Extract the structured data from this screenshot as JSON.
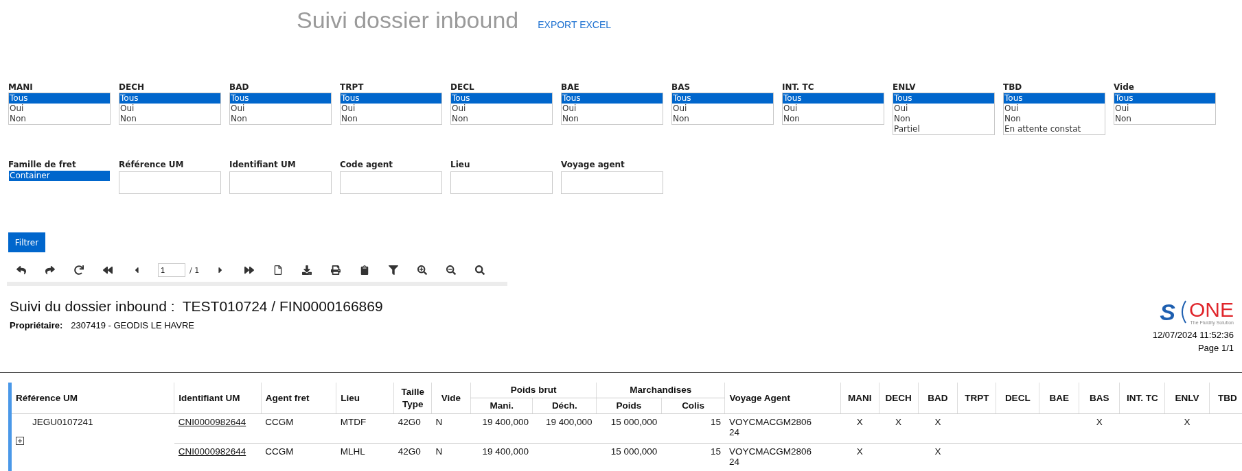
{
  "header": {
    "title": "Suivi dossier inbound",
    "export_link": "EXPORT EXCEL"
  },
  "filters": [
    {
      "label": "MANI",
      "options": [
        {
          "label": "Tous",
          "selected": true
        },
        {
          "label": "Oui",
          "selected": false
        },
        {
          "label": "Non",
          "selected": false
        }
      ]
    },
    {
      "label": "DECH",
      "options": [
        {
          "label": "Tous",
          "selected": true
        },
        {
          "label": "Oui",
          "selected": false
        },
        {
          "label": "Non",
          "selected": false
        }
      ]
    },
    {
      "label": "BAD",
      "options": [
        {
          "label": "Tous",
          "selected": true
        },
        {
          "label": "Oui",
          "selected": false
        },
        {
          "label": "Non",
          "selected": false
        }
      ]
    },
    {
      "label": "TRPT",
      "options": [
        {
          "label": "Tous",
          "selected": true
        },
        {
          "label": "Oui",
          "selected": false
        },
        {
          "label": "Non",
          "selected": false
        }
      ]
    },
    {
      "label": "DECL",
      "options": [
        {
          "label": "Tous",
          "selected": true
        },
        {
          "label": "Oui",
          "selected": false
        },
        {
          "label": "Non",
          "selected": false
        }
      ]
    },
    {
      "label": "BAE",
      "options": [
        {
          "label": "Tous",
          "selected": true
        },
        {
          "label": "Oui",
          "selected": false
        },
        {
          "label": "Non",
          "selected": false
        }
      ]
    },
    {
      "label": "BAS",
      "options": [
        {
          "label": "Tous",
          "selected": true
        },
        {
          "label": "Oui",
          "selected": false
        },
        {
          "label": "Non",
          "selected": false
        }
      ]
    },
    {
      "label": "INT. TC",
      "options": [
        {
          "label": "Tous",
          "selected": true
        },
        {
          "label": "Oui",
          "selected": false
        },
        {
          "label": "Non",
          "selected": false
        }
      ]
    },
    {
      "label": "ENLV",
      "options": [
        {
          "label": "Tous",
          "selected": true
        },
        {
          "label": "Oui",
          "selected": false
        },
        {
          "label": "Non",
          "selected": false
        },
        {
          "label": "Partiel",
          "selected": false
        }
      ]
    },
    {
      "label": "TBD",
      "options": [
        {
          "label": "Tous",
          "selected": true
        },
        {
          "label": "Oui",
          "selected": false
        },
        {
          "label": "Non",
          "selected": false
        },
        {
          "label": "En attente constat",
          "selected": false
        }
      ]
    },
    {
      "label": "Vide",
      "options": [
        {
          "label": "Tous",
          "selected": true
        },
        {
          "label": "Oui",
          "selected": false
        },
        {
          "label": "Non",
          "selected": false
        }
      ]
    }
  ],
  "fields": [
    {
      "label": "Famille de fret",
      "kind": "listbox",
      "options": [
        {
          "label": "Container",
          "selected": true
        }
      ]
    },
    {
      "label": "Référence UM",
      "kind": "text"
    },
    {
      "label": "Identifiant UM",
      "kind": "text"
    },
    {
      "label": "Code agent",
      "kind": "text"
    },
    {
      "label": "Lieu",
      "kind": "text"
    },
    {
      "label": "Voyage agent",
      "kind": "text"
    }
  ],
  "filter_button": "Filtrer",
  "toolbar": {
    "page": "1",
    "total": "/ 1"
  },
  "report": {
    "title": "Suivi du dossier inbound :  TEST010724 / FIN0000166869",
    "owner_label": "Propriétaire:",
    "owner": "2307419 - GEODIS LE HAVRE",
    "logo": {
      "mark": "S",
      "name": "ONE",
      "tagline": "The Fluidity Solution"
    },
    "date": "12/07/2024 11:52:36",
    "page": "Page 1/1"
  },
  "table": {
    "columns": [
      {
        "kind": "single",
        "label": "Référence UM"
      },
      {
        "kind": "single",
        "label": "Identifiant UM"
      },
      {
        "kind": "single",
        "label": "Agent fret"
      },
      {
        "kind": "single",
        "label": "Lieu"
      },
      {
        "kind": "single",
        "label": "Taille Type"
      },
      {
        "kind": "single",
        "label": "Vide"
      },
      {
        "kind": "group",
        "label": "Poids brut",
        "children": [
          "Mani.",
          "Déch."
        ]
      },
      {
        "kind": "group",
        "label": "Marchandises",
        "children": [
          "Poids",
          "Colis"
        ]
      },
      {
        "kind": "single",
        "label": "Voyage Agent"
      },
      {
        "kind": "single",
        "label": "MANI"
      },
      {
        "kind": "single",
        "label": "DECH"
      },
      {
        "kind": "single",
        "label": "BAD"
      },
      {
        "kind": "single",
        "label": "TRPT"
      },
      {
        "kind": "single",
        "label": "DECL"
      },
      {
        "kind": "single",
        "label": "BAE"
      },
      {
        "kind": "single",
        "label": "BAS"
      },
      {
        "kind": "single",
        "label": "INT. TC"
      },
      {
        "kind": "single",
        "label": "ENLV"
      },
      {
        "kind": "single",
        "label": "TBD"
      }
    ],
    "groups": [
      {
        "reference": "JEGU0107241",
        "expanded": false,
        "rows": [
          {
            "identifiant": "CNI0000982644",
            "agent": "CCGM",
            "lieu": "MTDF",
            "type": "42G0",
            "vide": "N",
            "mani": "19 400,000",
            "dech": "19 400,000",
            "poids": "15 000,000",
            "colis": "15",
            "voyage": "VOYCMACGM280624",
            "flags": {
              "mani": "X",
              "dech": "X",
              "bad": "X",
              "bas": "X",
              "enlv": "X"
            }
          },
          {
            "identifiant": "CNI0000982644",
            "agent": "CCGM",
            "lieu": "MLHL",
            "type": "42G0",
            "vide": "N",
            "mani": "19 400,000",
            "poids": "15 000,000",
            "colis": "15",
            "voyage": "VOYCMACGM280624",
            "flags": {
              "mani": "X",
              "bad": "X"
            }
          }
        ]
      }
    ]
  }
}
